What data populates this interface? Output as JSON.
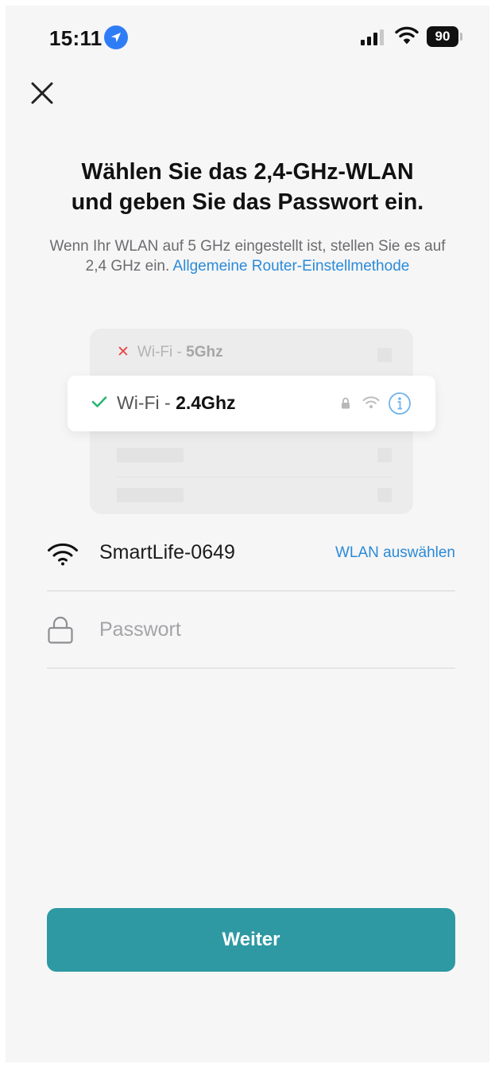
{
  "status_bar": {
    "time": "15:11",
    "battery": "90"
  },
  "header": {
    "title_line1": "Wählen Sie das 2,4-GHz-WLAN",
    "title_line2": "und geben Sie das Passwort ein.",
    "subtitle_text": "Wenn Ihr WLAN auf 5 GHz eingestellt ist, stellen Sie es auf 2,4 GHz ein.",
    "subtitle_link": "Allgemeine Router-Einstellmethode"
  },
  "illustration": {
    "row_5ghz_prefix": "Wi-Fi - ",
    "row_5ghz_band": "5Ghz",
    "row_24ghz_prefix": "Wi-Fi - ",
    "row_24ghz_band": "2.4Ghz"
  },
  "form": {
    "ssid": "SmartLife-0649",
    "select_wlan_label": "WLAN auswählen",
    "password_placeholder": "Passwort",
    "password_value": ""
  },
  "footer": {
    "next_label": "Weiter"
  },
  "colors": {
    "accent": "#2e99a3",
    "link": "#2b8ad8",
    "error_x": "#e8474a",
    "check": "#2bb673"
  }
}
